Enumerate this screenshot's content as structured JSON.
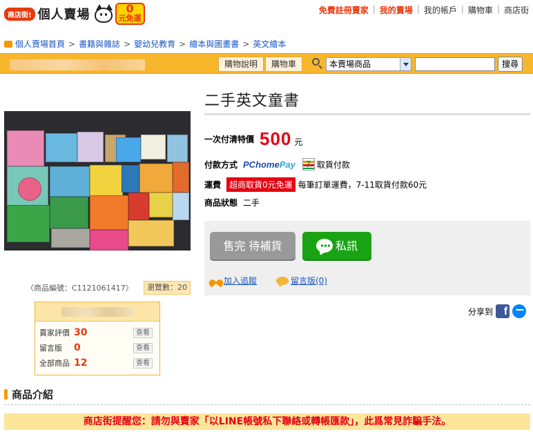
{
  "header": {
    "logo_badge": "商店街!",
    "logo_text": "個人賣場",
    "logo_zero": "0",
    "logo_zero_sub": "元免運",
    "links": [
      {
        "label": "免費註冊賣家",
        "highlight": true
      },
      {
        "label": "我的賣場",
        "highlight": true
      },
      {
        "label": "我的帳戶",
        "highlight": false
      },
      {
        "label": "購物車",
        "highlight": false
      },
      {
        "label": "商店街",
        "highlight": false
      }
    ]
  },
  "breadcrumb": [
    "個人賣場首頁",
    "書籍與雜誌",
    "嬰幼兒教育",
    "繪本與圖畫書",
    "英文繪本"
  ],
  "navbar": {
    "links": [
      "購物說明",
      "購物車"
    ],
    "search_scope": "本賣場商品",
    "search_value": "",
    "search_button": "搜尋"
  },
  "product": {
    "title": "二手英文童書",
    "price_label": "一次付清特價",
    "price": "500",
    "price_unit": "元",
    "payment_label": "付款方式",
    "payment_pchome_1": "PChome",
    "payment_pchome_2": "Pay",
    "seven_icon_text": "7",
    "payment_cod": "取貨付款",
    "shipping_label": "運費",
    "shipping_badge": "超商取貨0元免運",
    "shipping_text": "每筆訂單運費，7-11取貨付款60元",
    "condition_label": "商品狀態",
    "condition_value": "二手",
    "product_id": "〈商品編號：C1121061417〉",
    "view_count": "瀏覽數：20"
  },
  "actions": {
    "soldout": "售完 待補貨",
    "pm": "私訊",
    "follow": "加入追蹤",
    "comment": "留言版(0)"
  },
  "seller": {
    "rows": [
      {
        "label": "賣家評價",
        "value": "30",
        "action": "查看"
      },
      {
        "label": "留言版",
        "value": "0",
        "action": "查看"
      },
      {
        "label": "全部商品",
        "value": "12",
        "action": "查看"
      }
    ]
  },
  "share": {
    "label": "分享到",
    "fb": "f"
  },
  "section": {
    "title": "商品介紹"
  },
  "warning": "商店街提醒您：請勿與賣家「以LINE帳號私下聯絡或轉帳匯款」，此爲常見詐騙手法。",
  "colors": {
    "accent_orange": "#f8b62d",
    "price_red": "#e60012",
    "pm_green": "#1aa314",
    "link_blue": "#1a56c2"
  },
  "icons": [
    "home-icon",
    "search-icon",
    "chevron-down-icon",
    "seven-eleven-icon",
    "chat-bubble-icon",
    "heart-icon",
    "comment-icon",
    "facebook-icon",
    "messenger-icon"
  ]
}
